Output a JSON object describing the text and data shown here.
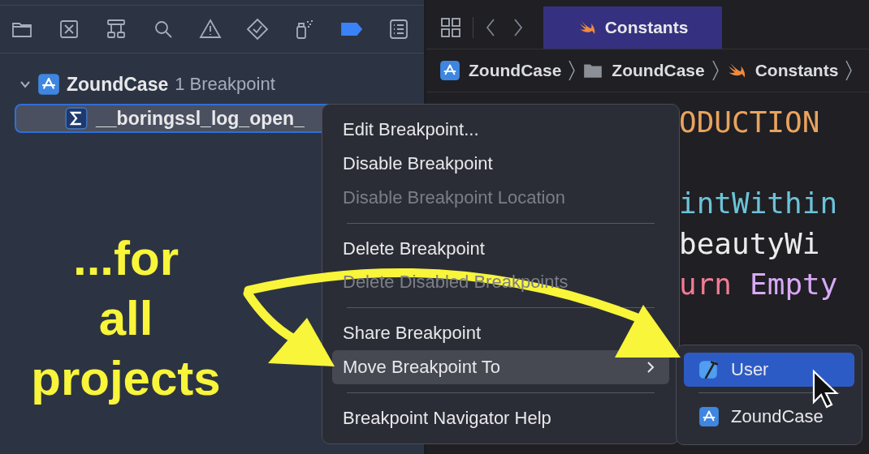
{
  "navigator": {
    "toolbar": [
      {
        "kind": "folder",
        "selected": false
      },
      {
        "kind": "cross-box",
        "selected": false
      },
      {
        "kind": "hierarchy",
        "selected": false
      },
      {
        "kind": "search",
        "selected": false
      },
      {
        "kind": "warning",
        "selected": false
      },
      {
        "kind": "diamond-check",
        "selected": false
      },
      {
        "kind": "spray",
        "selected": false
      },
      {
        "kind": "breakpoint",
        "selected": true
      },
      {
        "kind": "list",
        "selected": false
      }
    ],
    "tree": [
      {
        "name": "ZoundCase",
        "detail": "1 Breakpoint",
        "expanded": true,
        "children": [
          {
            "name": "__boringssl_log_open_",
            "selected": true
          }
        ]
      }
    ]
  },
  "editor": {
    "tabs": [
      {
        "label": "Constants",
        "selected": true
      }
    ],
    "breadcrumb": [
      {
        "label": "ZoundCase",
        "kind": "project"
      },
      {
        "label": "ZoundCase",
        "kind": "folder"
      },
      {
        "label": "Constants",
        "kind": "swift"
      }
    ],
    "code_lines": [
      {
        "tokens": [
          {
            "text": "ODUCTION",
            "kind": "constant"
          }
        ]
      },
      {
        "tokens": [
          {
            "text": "intWithin",
            "kind": "function"
          }
        ]
      },
      {
        "tokens": [
          {
            "text": "beautyWi",
            "kind": "plain"
          }
        ]
      },
      {
        "tokens": [
          {
            "text": "urn",
            "kind": "keyword"
          },
          {
            "text": "Empty",
            "kind": "type"
          }
        ]
      }
    ]
  },
  "context_menu": {
    "groups": [
      [
        {
          "label": "Edit Breakpoint...",
          "disabled": false,
          "selected": false,
          "submenu": false
        },
        {
          "label": "Disable Breakpoint",
          "disabled": false,
          "selected": false,
          "submenu": false
        },
        {
          "label": "Disable Breakpoint Location",
          "disabled": true,
          "selected": false,
          "submenu": false
        }
      ],
      [
        {
          "label": "Delete Breakpoint",
          "disabled": false,
          "selected": false,
          "submenu": false
        },
        {
          "label": "Delete Disabled Breakpoints",
          "disabled": true,
          "selected": false,
          "submenu": false
        }
      ],
      [
        {
          "label": "Share Breakpoint",
          "disabled": false,
          "selected": false,
          "submenu": false
        },
        {
          "label": "Move Breakpoint To",
          "disabled": false,
          "selected": true,
          "submenu": true
        }
      ],
      [
        {
          "label": "Breakpoint Navigator Help",
          "disabled": false,
          "selected": false,
          "submenu": false
        }
      ]
    ]
  },
  "submenu": {
    "items": [
      {
        "label": "User",
        "kind": "user",
        "selected": true
      },
      {
        "label": "ZoundCase",
        "kind": "project",
        "selected": false
      }
    ]
  },
  "annotation": {
    "lines": [
      "...for",
      "all",
      "projects"
    ]
  }
}
